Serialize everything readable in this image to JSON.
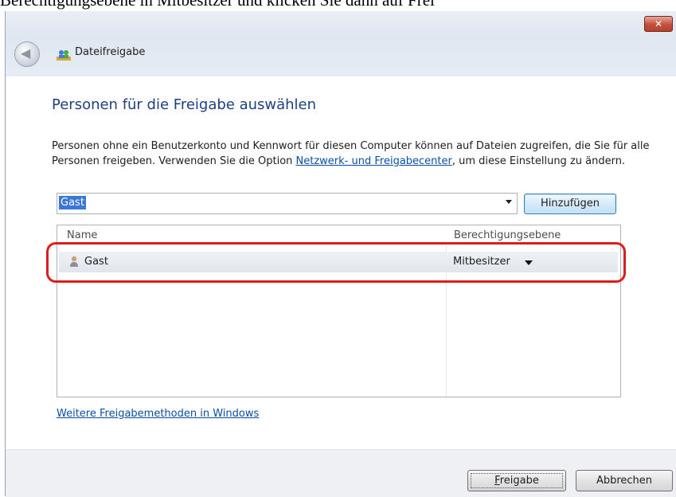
{
  "top_caption": "Berechtigungsebene in Mitbesitzer und klicken Sie dann auf Frei",
  "titlebar": {
    "close_label": "✕",
    "title": "Dateifreigabe"
  },
  "heading": "Personen für die Freigabe auswählen",
  "intro": {
    "text_before_link": "Personen ohne ein Benutzerkonto und Kennwort für diesen Computer können auf Dateien zugreifen, die Sie für alle Personen freigeben. Verwenden Sie die Option ",
    "link": "Netzwerk- und Freigabecenter",
    "text_after_link": ", um diese Einstellung zu ändern."
  },
  "user_combo": {
    "value": "Gast"
  },
  "add_button": "Hinzufügen",
  "list": {
    "columns": [
      "Name",
      "Berechtigungsebene"
    ],
    "rows": [
      {
        "name": "Gast",
        "permission": "Mitbesitzer"
      }
    ]
  },
  "more_link": "Weitere Freigabemethoden in Windows",
  "footer": {
    "share_button": {
      "mnemonic": "F",
      "rest": "reigabe"
    },
    "cancel_button": "Abbrechen"
  },
  "colors": {
    "heading": "#1e3f82",
    "link": "#0a4fa5",
    "highlight": "#e11b1b",
    "selection": "#3a78d6"
  }
}
